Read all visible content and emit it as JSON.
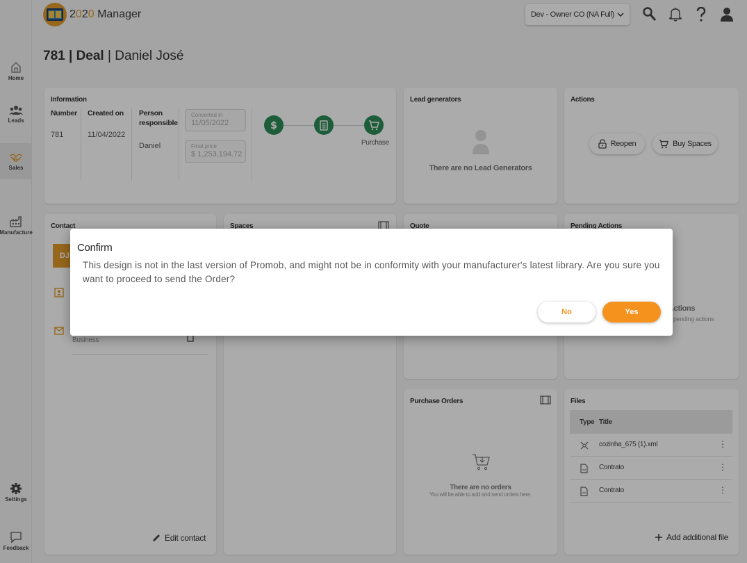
{
  "app": {
    "logo_prefix": "2",
    "logo_accent": "0",
    "logo_mid": "2",
    "logo_accent2": "0",
    "logo_suffix": " Manager"
  },
  "header": {
    "org_select": "Dev - Owner CO (NA Full)"
  },
  "sidebar": {
    "items": [
      {
        "label": "Home",
        "icon": "home-icon"
      },
      {
        "label": "Leads",
        "icon": "users-icon"
      },
      {
        "label": "Sales",
        "icon": "handshake-icon"
      },
      {
        "label": "Manufacture",
        "icon": "factory-icon"
      },
      {
        "label": "Settings",
        "icon": "gear-icon"
      },
      {
        "label": "Feedback",
        "icon": "chat-icon"
      }
    ]
  },
  "page": {
    "number": "781",
    "type": "Deal",
    "customer": "Daniel José"
  },
  "information": {
    "title": "Information",
    "number_label": "Number",
    "number_value": "781",
    "created_label": "Created on",
    "created_value": "11/04/2022",
    "person_label_1": "Person",
    "person_label_2": "responsible",
    "person_value": "Daniel",
    "converted_label": "Converted in",
    "converted_value": "11/05/2022",
    "final_price_label": "Final price",
    "final_price_value": "$ 1,253,194.72",
    "purchase_label": "Purchase"
  },
  "lead_generators": {
    "title": "Lead generators",
    "empty": "There are no Lead Generators"
  },
  "actions": {
    "title": "Actions",
    "reopen": "Reopen",
    "buy_spaces": "Buy Spaces"
  },
  "contact": {
    "title": "Contact",
    "initials": "DJ",
    "business": "Business",
    "edit": "Edit contact"
  },
  "spaces": {
    "title": "Spaces"
  },
  "quote": {
    "title": "Quote"
  },
  "pending_actions": {
    "title": "Pending Actions",
    "empty_title": "Actions",
    "empty_sub": "e pending actions"
  },
  "purchase_orders": {
    "title": "Purchase Orders",
    "empty_title": "There are no orders",
    "empty_sub": "You will be able to add and send orders here."
  },
  "files": {
    "title": "Files",
    "col_type": "Type",
    "col_title": "Title",
    "rows": [
      {
        "title": "cozinha_675 (1).xml",
        "icon": "puzzle-icon"
      },
      {
        "title": "Contrato",
        "icon": "document-icon"
      },
      {
        "title": "Contrato",
        "icon": "document-icon"
      }
    ],
    "add": "Add additional file"
  },
  "dialog": {
    "title": "Confirm",
    "body": "This design is not in the last version of Promob, and might not be in conformity with your manufacturer's latest library. Are you sure you want to proceed to send the Order?",
    "no": "No",
    "yes": "Yes"
  },
  "colors": {
    "accent": "#f5921e",
    "step_green": "#2e8b57",
    "contact_avatar": "#e09a2b"
  }
}
